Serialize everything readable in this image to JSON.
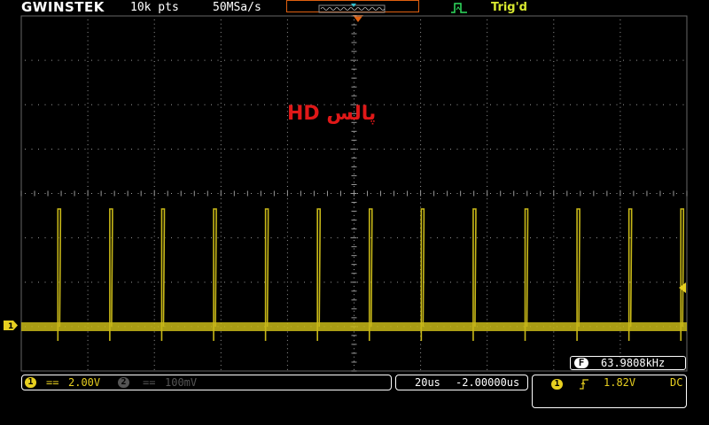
{
  "header": {
    "brand": "GWINSTEK",
    "record_length": "10k pts",
    "sample_rate": "50MSa/s",
    "trigger_status": "Trig'd"
  },
  "overlay": {
    "title": "پالس HD"
  },
  "measurement": {
    "badge": "F",
    "frequency": "63.9808kHz"
  },
  "channels": {
    "ch1": {
      "badge": "1",
      "coupling": "==",
      "scale": "2.00V",
      "color": "#e8d020"
    },
    "ch2": {
      "badge": "2",
      "coupling": "==",
      "scale": "100mV",
      "color": "#555555"
    }
  },
  "timebase": {
    "time_div": "20us",
    "position": "-2.00000us"
  },
  "trigger": {
    "source": "1",
    "slope_icon": "rising-edge-icon",
    "level": "1.82V",
    "coupling": "DC"
  },
  "colors": {
    "trace": "#c8b818",
    "grid": "#9a9a9a",
    "trigger_marker": "#e06010",
    "overlay_text": "#e01818"
  },
  "waveform": {
    "pulse_period_divisions": 0.78,
    "first_pulse_division": 0.55
  }
}
